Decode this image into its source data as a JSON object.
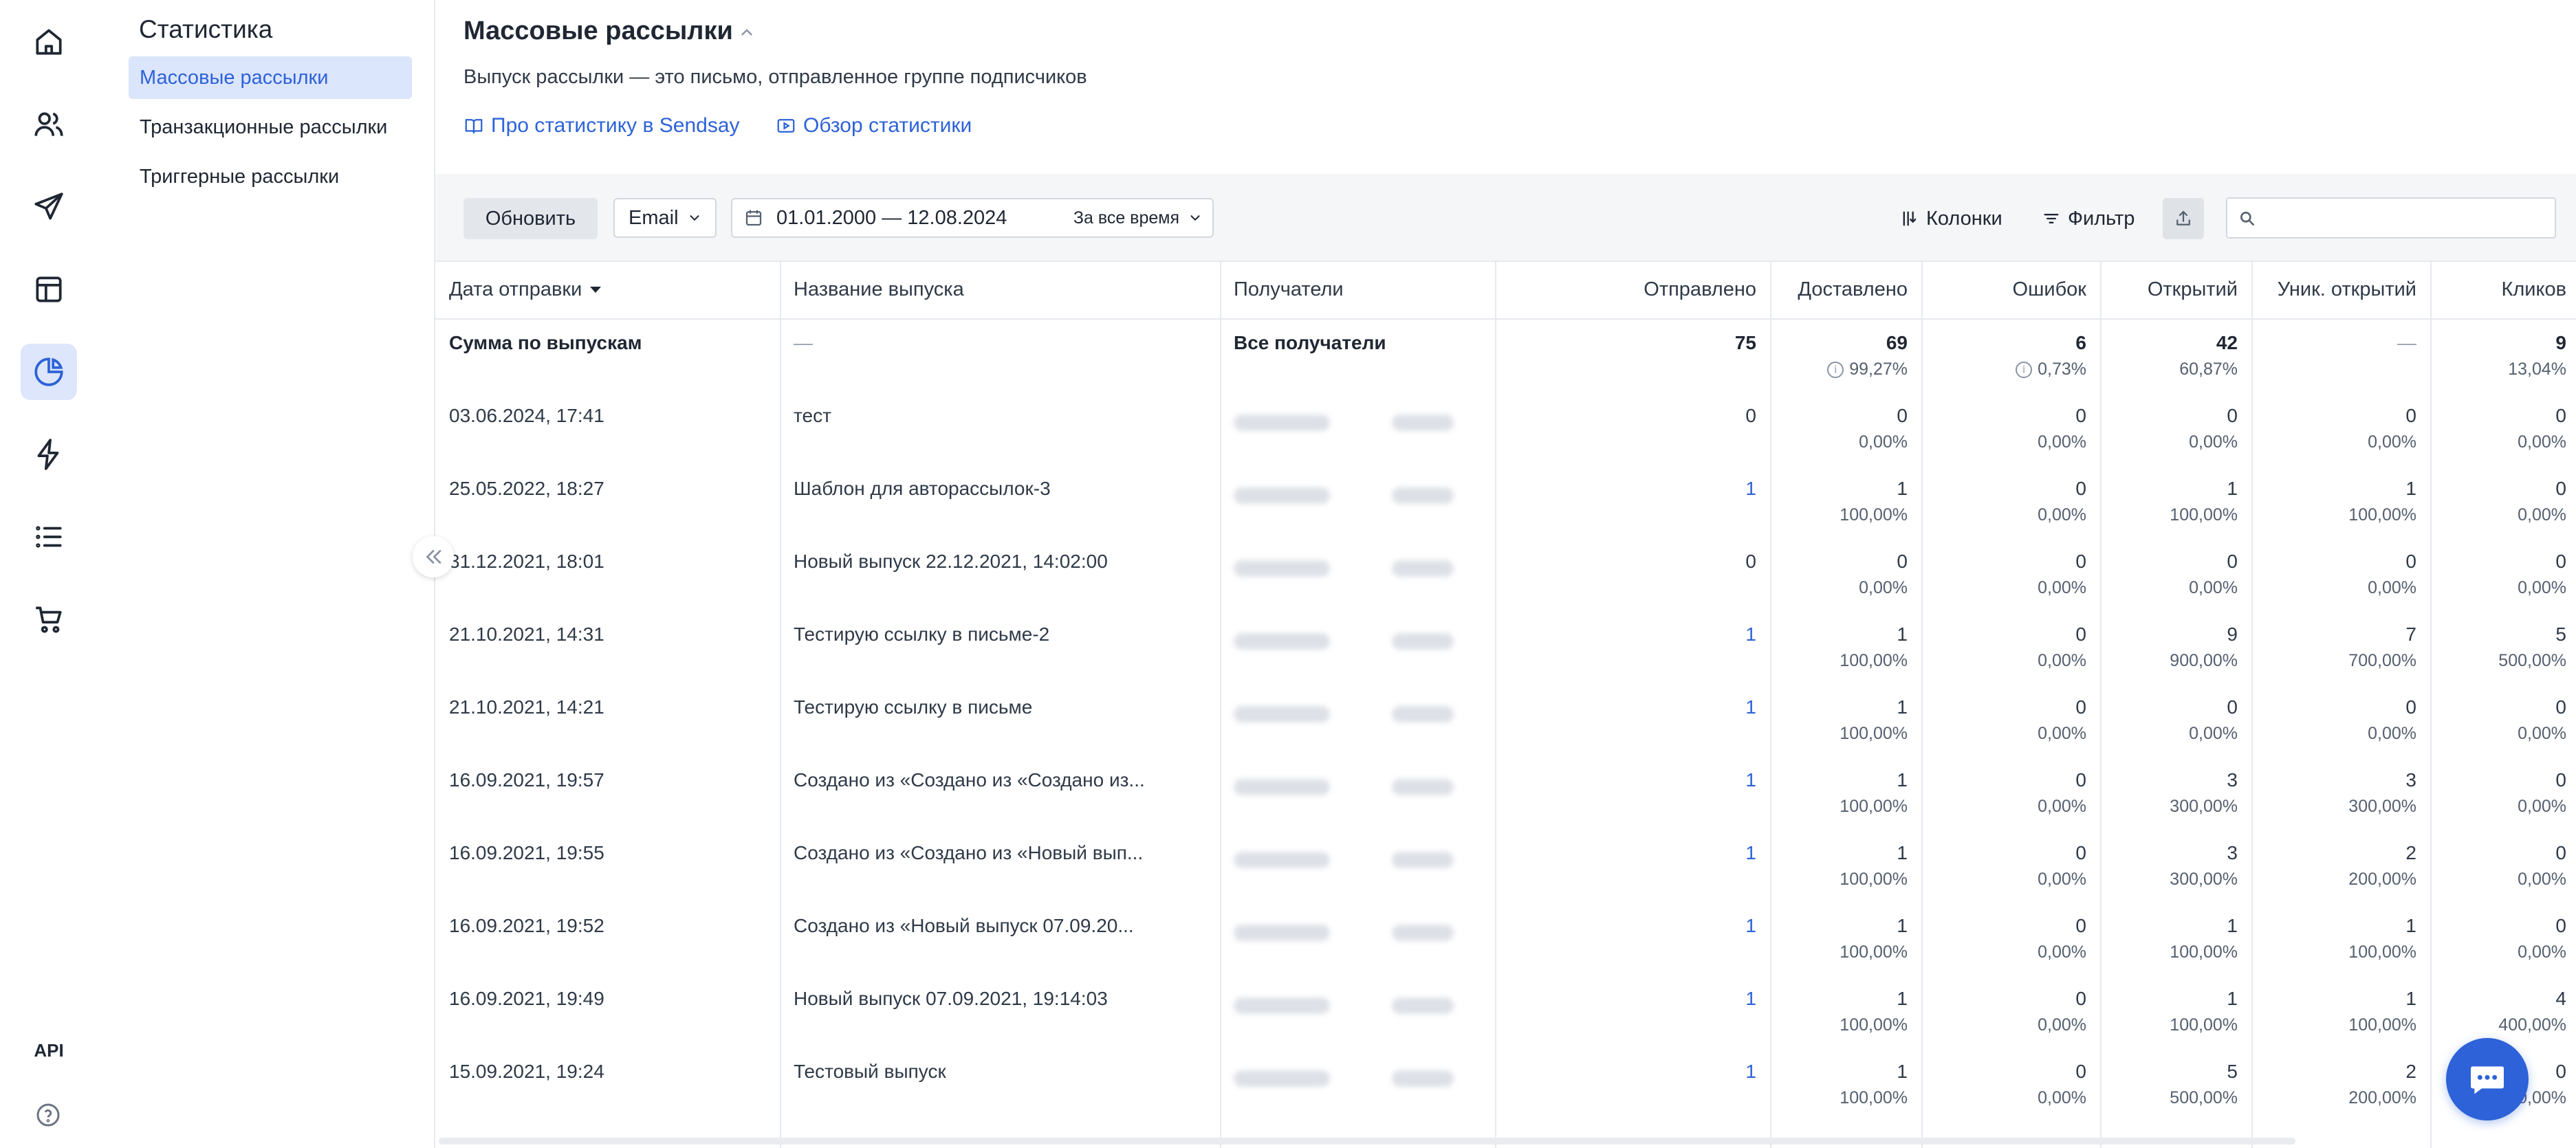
{
  "rail": {
    "items": [
      {
        "icon": "home-icon"
      },
      {
        "icon": "users-icon"
      },
      {
        "icon": "send-icon"
      },
      {
        "icon": "layout-icon"
      },
      {
        "icon": "pie-chart-icon",
        "active": true
      },
      {
        "icon": "lightning-icon"
      },
      {
        "icon": "list-icon"
      },
      {
        "icon": "cart-icon"
      }
    ],
    "api_label": "API",
    "help_icon": "help-circle-icon"
  },
  "subnav": {
    "title": "Статистика",
    "items": [
      {
        "label": "Массовые рассылки",
        "active": true
      },
      {
        "label": "Транзакционные рассылки"
      },
      {
        "label": "Триггерные рассылки"
      }
    ]
  },
  "header": {
    "title": "Массовые рассылки",
    "description": "Выпуск рассылки — это письмо, отправленное группе подписчиков",
    "link_docs": "Про статистику в Sendsay",
    "link_video": "Обзор статистики"
  },
  "toolbar": {
    "refresh_label": "Обновить",
    "channel_value": "Email",
    "date_range": "01.01.2000 — 12.08.2024",
    "period_value": "За все время",
    "columns_label": "Колонки",
    "filter_label": "Фильтр",
    "search_placeholder": ""
  },
  "colors": {
    "accent": "#2d62d8",
    "active_bg": "#dbe5fb",
    "toolbar_bg": "#f5f6f8"
  },
  "table": {
    "columns": [
      "Дата отправки",
      "Название выпуска",
      "Получатели",
      "Отправлено",
      "Доставлено",
      "Ошибок",
      "Открытий",
      "Уник. открытий",
      "Кликов"
    ],
    "summary": {
      "date": "Сумма по выпускам",
      "name": "—",
      "recipients": "Все получатели",
      "sent": "75",
      "delivered": "69",
      "delivered_pct": "99,27%",
      "errors": "6",
      "errors_pct": "0,73%",
      "opens": "42",
      "opens_pct": "60,87%",
      "unique_opens": "—",
      "clicks": "9",
      "clicks_pct": "13,04%"
    },
    "rows": [
      {
        "date": "03.06.2024, 17:41",
        "name": "тест",
        "sent": "0",
        "delivered": "0",
        "delivered_pct": "0,00%",
        "errors": "0",
        "errors_pct": "0,00%",
        "opens": "0",
        "opens_pct": "0,00%",
        "unique_opens": "0",
        "unique_opens_pct": "0,00%",
        "clicks": "0",
        "clicks_pct": "0,00%"
      },
      {
        "date": "25.05.2022, 18:27",
        "name": "Шаблон для авторассылок-3",
        "sent": "1",
        "delivered": "1",
        "delivered_pct": "100,00%",
        "errors": "0",
        "errors_pct": "0,00%",
        "opens": "1",
        "opens_pct": "100,00%",
        "unique_opens": "1",
        "unique_opens_pct": "100,00%",
        "clicks": "0",
        "clicks_pct": "0,00%"
      },
      {
        "date": "31.12.2021, 18:01",
        "name": "Новый выпуск 22.12.2021, 14:02:00",
        "sent": "0",
        "delivered": "0",
        "delivered_pct": "0,00%",
        "errors": "0",
        "errors_pct": "0,00%",
        "opens": "0",
        "opens_pct": "0,00%",
        "unique_opens": "0",
        "unique_opens_pct": "0,00%",
        "clicks": "0",
        "clicks_pct": "0,00%"
      },
      {
        "date": "21.10.2021, 14:31",
        "name": "Тестирую ссылку в письме-2",
        "sent": "1",
        "delivered": "1",
        "delivered_pct": "100,00%",
        "errors": "0",
        "errors_pct": "0,00%",
        "opens": "9",
        "opens_pct": "900,00%",
        "unique_opens": "7",
        "unique_opens_pct": "700,00%",
        "clicks": "5",
        "clicks_pct": "500,00%"
      },
      {
        "date": "21.10.2021, 14:21",
        "name": "Тестирую ссылку в письме",
        "sent": "1",
        "delivered": "1",
        "delivered_pct": "100,00%",
        "errors": "0",
        "errors_pct": "0,00%",
        "opens": "0",
        "opens_pct": "0,00%",
        "unique_opens": "0",
        "unique_opens_pct": "0,00%",
        "clicks": "0",
        "clicks_pct": "0,00%"
      },
      {
        "date": "16.09.2021, 19:57",
        "name": "Создано из «Создано из «Создано из...",
        "sent": "1",
        "delivered": "1",
        "delivered_pct": "100,00%",
        "errors": "0",
        "errors_pct": "0,00%",
        "opens": "3",
        "opens_pct": "300,00%",
        "unique_opens": "3",
        "unique_opens_pct": "300,00%",
        "clicks": "0",
        "clicks_pct": "0,00%"
      },
      {
        "date": "16.09.2021, 19:55",
        "name": "Создано из «Создано из «Новый вып...",
        "sent": "1",
        "delivered": "1",
        "delivered_pct": "100,00%",
        "errors": "0",
        "errors_pct": "0,00%",
        "opens": "3",
        "opens_pct": "300,00%",
        "unique_opens": "2",
        "unique_opens_pct": "200,00%",
        "clicks": "0",
        "clicks_pct": "0,00%"
      },
      {
        "date": "16.09.2021, 19:52",
        "name": "Создано из «Новый выпуск 07.09.20...",
        "sent": "1",
        "delivered": "1",
        "delivered_pct": "100,00%",
        "errors": "0",
        "errors_pct": "0,00%",
        "opens": "1",
        "opens_pct": "100,00%",
        "unique_opens": "1",
        "unique_opens_pct": "100,00%",
        "clicks": "0",
        "clicks_pct": "0,00%"
      },
      {
        "date": "16.09.2021, 19:49",
        "name": "Новый выпуск 07.09.2021, 19:14:03",
        "sent": "1",
        "delivered": "1",
        "delivered_pct": "100,00%",
        "errors": "0",
        "errors_pct": "0,00%",
        "opens": "1",
        "opens_pct": "100,00%",
        "unique_opens": "1",
        "unique_opens_pct": "100,00%",
        "clicks": "4",
        "clicks_pct": "400,00%"
      },
      {
        "date": "15.09.2021, 19:24",
        "name": "Тестовый выпуск",
        "sent": "1",
        "delivered": "1",
        "delivered_pct": "100,00%",
        "errors": "0",
        "errors_pct": "0,00%",
        "opens": "5",
        "opens_pct": "500,00%",
        "unique_opens": "2",
        "unique_opens_pct": "200,00%",
        "clicks": "0",
        "clicks_pct": "0,00%"
      }
    ]
  },
  "chat_icon": "chat-bubble-icon",
  "collapse_icon": "double-chevron-left-icon"
}
